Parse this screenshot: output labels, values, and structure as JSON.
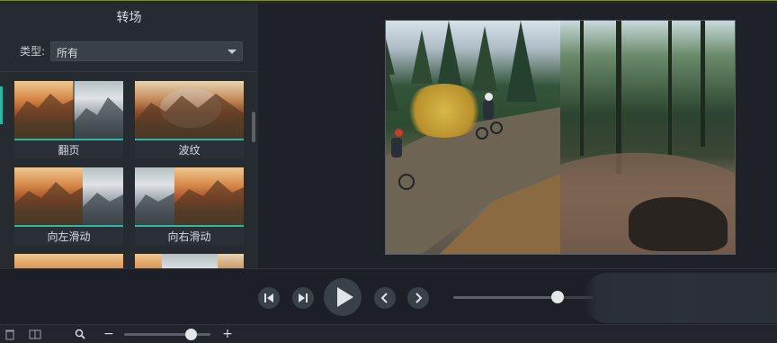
{
  "panel": {
    "title": "转场",
    "filter_label": "类型:",
    "filter_value": "所有"
  },
  "transitions": [
    {
      "label": "翻页"
    },
    {
      "label": "波纹"
    },
    {
      "label": "向左滑动"
    },
    {
      "label": "向右滑动"
    }
  ],
  "icons": {
    "filter_dropdown": "chevron-down-icon",
    "prev_frame": "step-back-icon",
    "next_frame": "step-forward-icon",
    "play": "play-icon",
    "prev": "chevron-left-icon",
    "next": "chevron-right-icon",
    "zoom": "search-icon",
    "zoom_out": "minus-icon",
    "zoom_in": "plus-icon"
  },
  "controls": {
    "zoom_out_glyph": "−",
    "zoom_in_glyph": "+",
    "playhead_fraction": 0.74,
    "zoom_fraction": 0.74
  },
  "colors": {
    "accent": "#2cb6a4",
    "background": "#1e2228",
    "panel": "#262b31"
  }
}
